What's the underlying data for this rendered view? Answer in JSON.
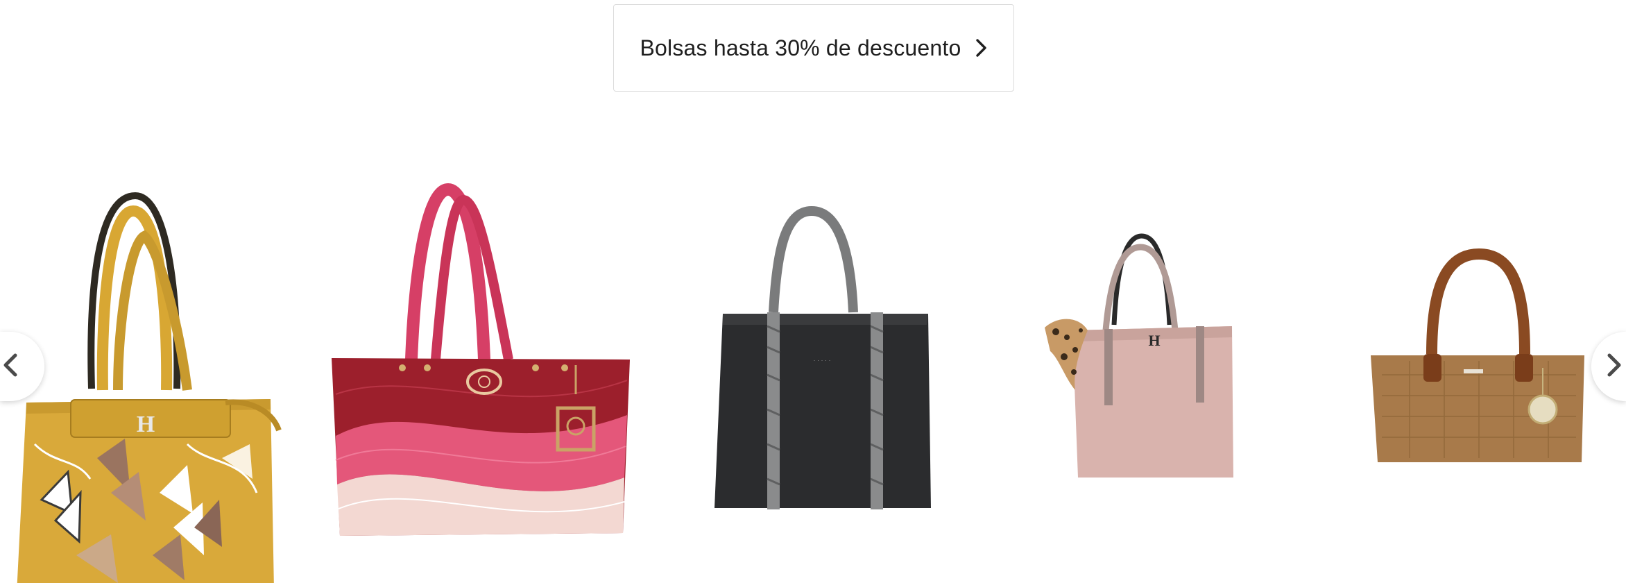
{
  "promo": {
    "label": "Bolsas hasta 30% de descuento",
    "icon": "chevron-right-icon"
  },
  "carousel": {
    "prev_icon": "chevron-left-icon",
    "next_icon": "chevron-right-icon",
    "products": [
      {
        "name": "mustard-butterfly-shoulder-bag",
        "color": "#d9a93a"
      },
      {
        "name": "red-pink-wave-quilted-tote",
        "color": "#c43e5c"
      },
      {
        "name": "black-tote-snake-handles",
        "color": "#2b2c2e"
      },
      {
        "name": "pink-suede-tote-leopard-scarf",
        "color": "#d9b3ad"
      },
      {
        "name": "tan-croc-satchel",
        "color": "#a87a4a"
      }
    ]
  }
}
